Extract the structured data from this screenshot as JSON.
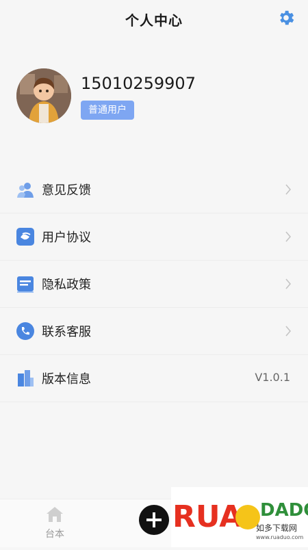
{
  "header": {
    "title": "个人中心",
    "settings_icon": "gear-icon"
  },
  "profile": {
    "phone": "15010259907",
    "badge": "普通用户"
  },
  "menu": [
    {
      "label": "意见反馈",
      "icon": "users-icon"
    },
    {
      "label": "用户协议",
      "icon": "handshake-icon"
    },
    {
      "label": "隐私政策",
      "icon": "document-icon"
    },
    {
      "label": "联系客服",
      "icon": "phone-icon"
    },
    {
      "label": "版本信息",
      "icon": "building-icon",
      "value": "V1.0.1"
    }
  ],
  "tabbar": {
    "home_label": "台本",
    "add_icon": "plus-icon"
  },
  "watermark": {
    "brand": "RUANDADO",
    "cn": "如多下载网",
    "url": "www.ruaduo.com"
  },
  "colors": {
    "accent": "#4a90e2",
    "badge": "#7ea6f2"
  }
}
